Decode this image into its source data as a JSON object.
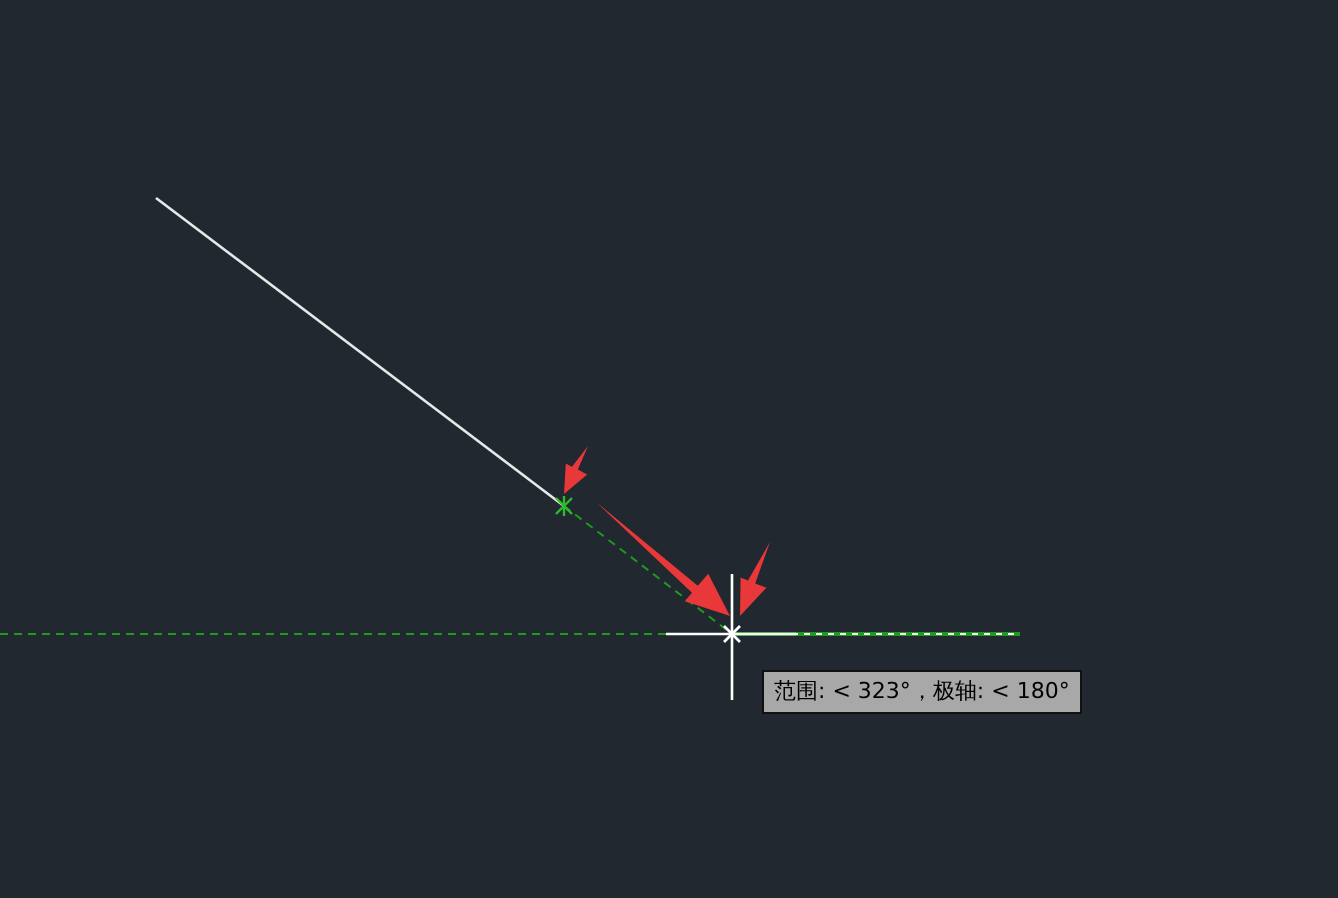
{
  "tooltip": {
    "text": "范围: < 323°，极轴: < 180°"
  }
}
